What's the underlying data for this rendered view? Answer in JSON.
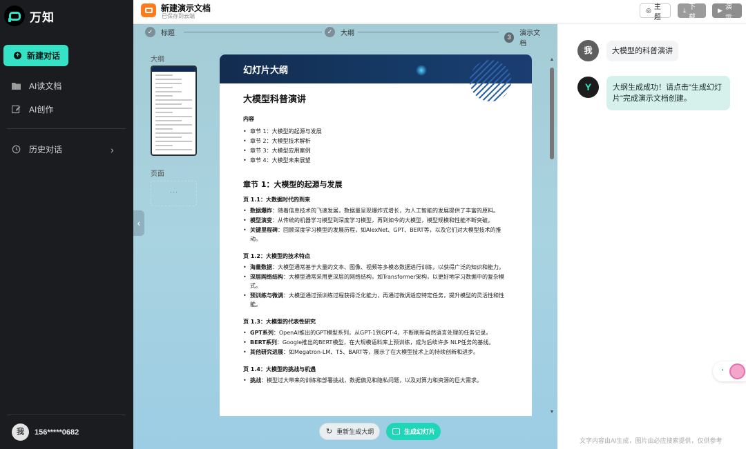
{
  "app": {
    "name": "万知"
  },
  "sidebar": {
    "new_chat": "新建对话",
    "items": [
      {
        "label": "AI读文档",
        "icon": "folder-icon"
      },
      {
        "label": "AI创作",
        "icon": "edit-icon"
      }
    ],
    "history": "历史对话",
    "user": {
      "avatar": "我",
      "phone": "156*****0682"
    }
  },
  "topbar": {
    "doc_title": "新建演示文档",
    "doc_status": "已保存到云端",
    "buttons": {
      "theme": "主题",
      "download": "下载",
      "present": "演示"
    }
  },
  "steps": [
    {
      "label": "标题",
      "state": "done"
    },
    {
      "label": "大纲",
      "state": "done"
    },
    {
      "label": "演示文档",
      "state": "current",
      "num": "3"
    }
  ],
  "left_panel": {
    "outline_label": "大纲",
    "pages_label": "页面",
    "pages_placeholder": "···"
  },
  "document": {
    "header": "幻灯片大纲",
    "title": "大模型科普演讲",
    "toc_heading": "内容",
    "toc": [
      "章节 1：大模型的起源与发展",
      "章节 2：大模型技术解析",
      "章节 3：大模型应用案例",
      "章节 4：大模型未来展望"
    ],
    "chapter1": "章节 1：大模型的起源与发展",
    "sections": [
      {
        "title": "页 1.1：大数据时代的到来",
        "points": [
          {
            "k": "数据爆炸",
            "v": "：随着信息技术的飞速发展，数据量呈现爆炸式增长，为人工智能的发展提供了丰富的原料。"
          },
          {
            "k": "模型演变",
            "v": "：从传统的机器学习模型到深度学习模型，再到如今的大模型，模型规模和性能不断突破。"
          },
          {
            "k": "关键里程碑",
            "v": "：回顾深度学习模型的发展历程，如AlexNet、GPT、BERT等，以及它们对大模型技术的推动。"
          }
        ]
      },
      {
        "title": "页 1.2：大模型的技术特点",
        "points": [
          {
            "k": "海量数据",
            "v": "：大模型通常基于大量的文本、图像、视频等多模态数据进行训练，以获得广泛的知识和能力。"
          },
          {
            "k": "深层网络结构",
            "v": "：大模型通常采用更深层的网络结构，如Transformer架构，以更好地学习数据中的复杂模式。"
          },
          {
            "k": "预训练与微调",
            "v": "：大模型通过预训练过程获得泛化能力，再通过微调适应特定任务，提升模型的灵活性和性能。"
          }
        ]
      },
      {
        "title": "页 1.3：大模型的代表性研究",
        "points": [
          {
            "k": "GPT系列",
            "v": "：OpenAI推出的GPT模型系列，从GPT-1到GPT-4，不断刷新自然语言处理的任务记录。"
          },
          {
            "k": "BERT系列",
            "v": "：Google推出的BERT模型，在大规模语料库上预训练，成为后续许多 NLP任务的基线。"
          },
          {
            "k": "其他研究进展",
            "v": "：如Megatron-LM、T5、BART等，展示了在大模型技术上的持续创新和进步。"
          }
        ]
      },
      {
        "title": "页 1.4：大模型的挑战与机遇",
        "points": [
          {
            "k": "挑战",
            "v": "：模型过大带来的训练和部署挑战，数据偏见和隐私问题，以及对算力和资源的巨大需求。"
          }
        ]
      }
    ]
  },
  "actions": {
    "regenerate": "重新生成大纲",
    "generate": "生成幻灯片"
  },
  "chat": {
    "user_avatar": "我",
    "user_message": "大模型的科普演讲",
    "bot_avatar": "Y",
    "bot_message": "大纲生成成功！请点击\"生成幻灯片\"完成演示文档创建。",
    "disclaimer": "文字内容由AI生成，图片由必应搜索提供，仅供参考"
  },
  "colors": {
    "accent": "#35e2c5",
    "sidebar_bg": "#1b1c1f",
    "doc_header": "#132c4f",
    "doc_icon": "#ff7a1a"
  }
}
